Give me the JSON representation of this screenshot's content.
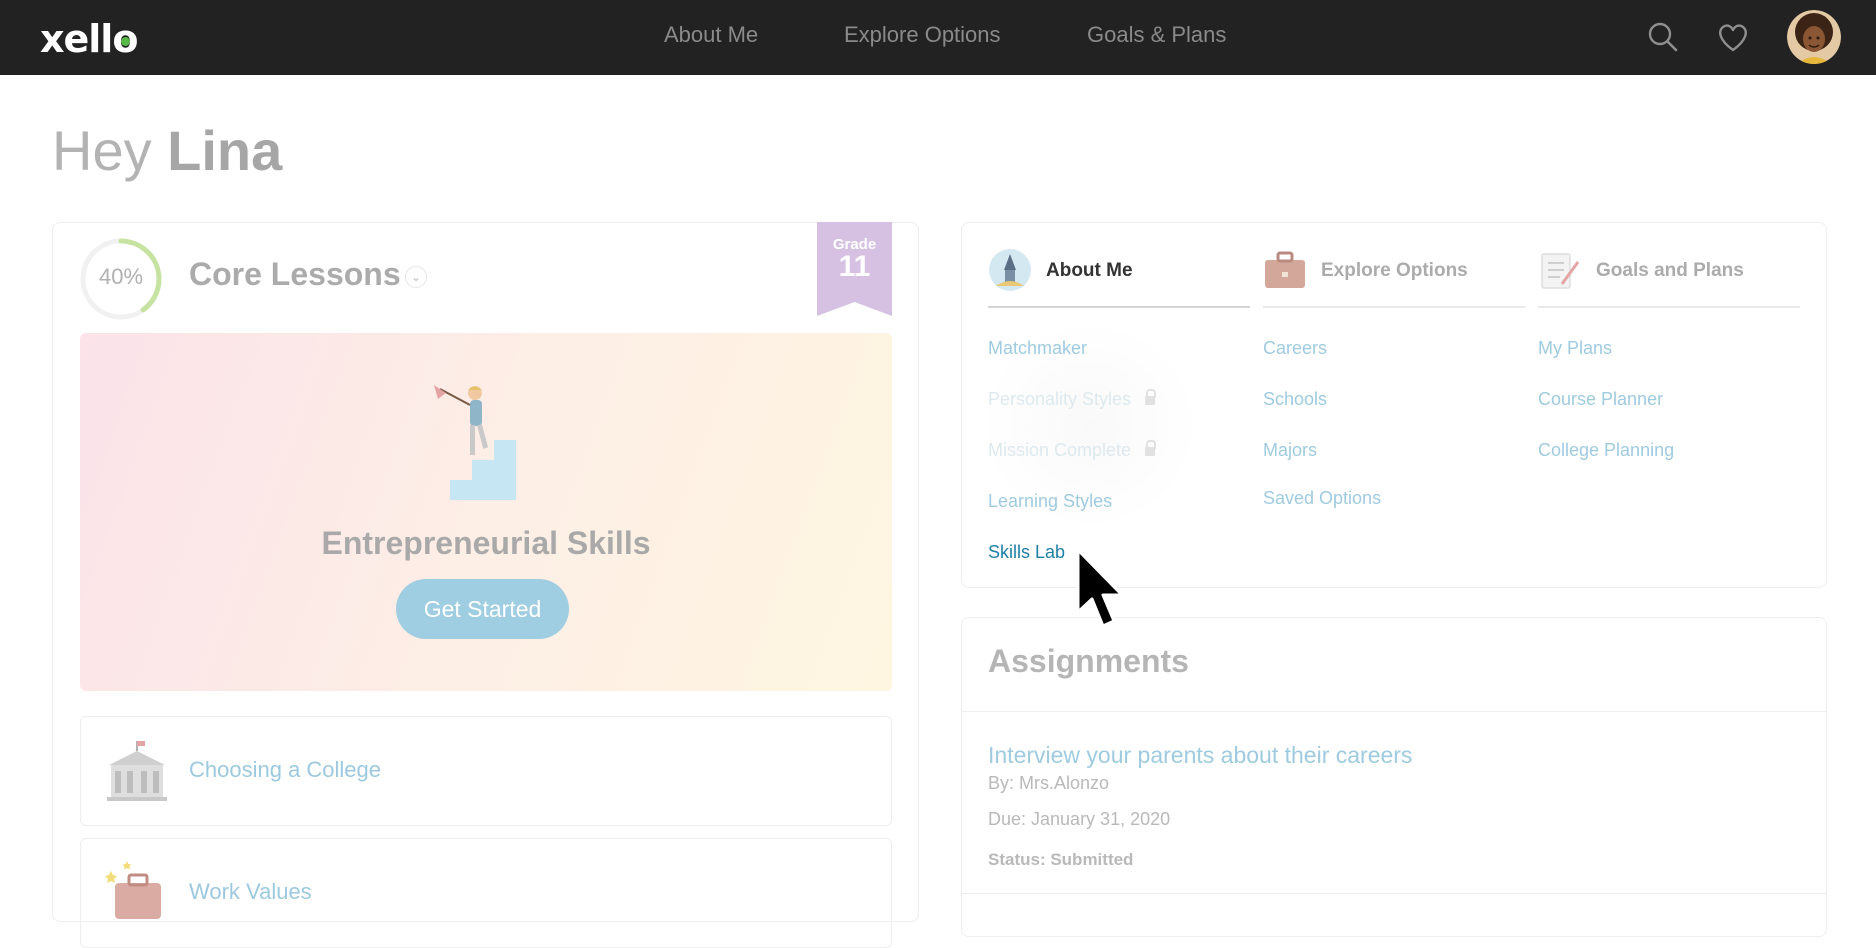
{
  "topbar": {
    "logo": "xello",
    "nav": [
      "About Me",
      "Explore Options",
      "Goals & Plans"
    ],
    "icons": [
      "search-icon",
      "heart-icon",
      "avatar"
    ]
  },
  "greeting": {
    "prefix": "Hey ",
    "name": "Lina"
  },
  "core_lessons": {
    "progress": "40%",
    "progress_value": 0.4,
    "title": "Core Lessons",
    "grade_label": "Grade",
    "grade_value": "11",
    "featured": {
      "title": "Entrepreneurial Skills",
      "button": "Get Started"
    },
    "lessons": [
      "Choosing a College",
      "Work Values"
    ]
  },
  "menu": {
    "columns": [
      {
        "title": "About Me",
        "active": true,
        "links": [
          {
            "label": "Matchmaker",
            "state": "normal"
          },
          {
            "label": "Personality Styles",
            "state": "locked"
          },
          {
            "label": "Mission Complete",
            "state": "locked"
          },
          {
            "label": "Learning Styles",
            "state": "normal"
          },
          {
            "label": "Skills Lab",
            "state": "focus"
          }
        ]
      },
      {
        "title": "Explore Options",
        "active": false,
        "links": [
          {
            "label": "Careers"
          },
          {
            "label": "Schools"
          },
          {
            "label": "Majors"
          },
          {
            "label": "Saved Options"
          }
        ]
      },
      {
        "title": "Goals and Plans",
        "active": false,
        "links": [
          {
            "label": "My Plans"
          },
          {
            "label": "Course Planner"
          },
          {
            "label": "College Planning"
          }
        ]
      }
    ]
  },
  "assignments": {
    "title": "Assignments",
    "items": [
      {
        "title": "Interview your parents about their careers",
        "by": "By: Mrs.Alonzo",
        "due": "Due: January 31, 2020",
        "status": "Status: Submitted"
      }
    ]
  },
  "colors": {
    "topbar": "#222222",
    "link": "#9fcbe0",
    "focus_link": "#1f7fa6",
    "grade_ribbon": "#d6c1e2",
    "button": "#9fcde2",
    "progress": "#c7e3a1"
  }
}
